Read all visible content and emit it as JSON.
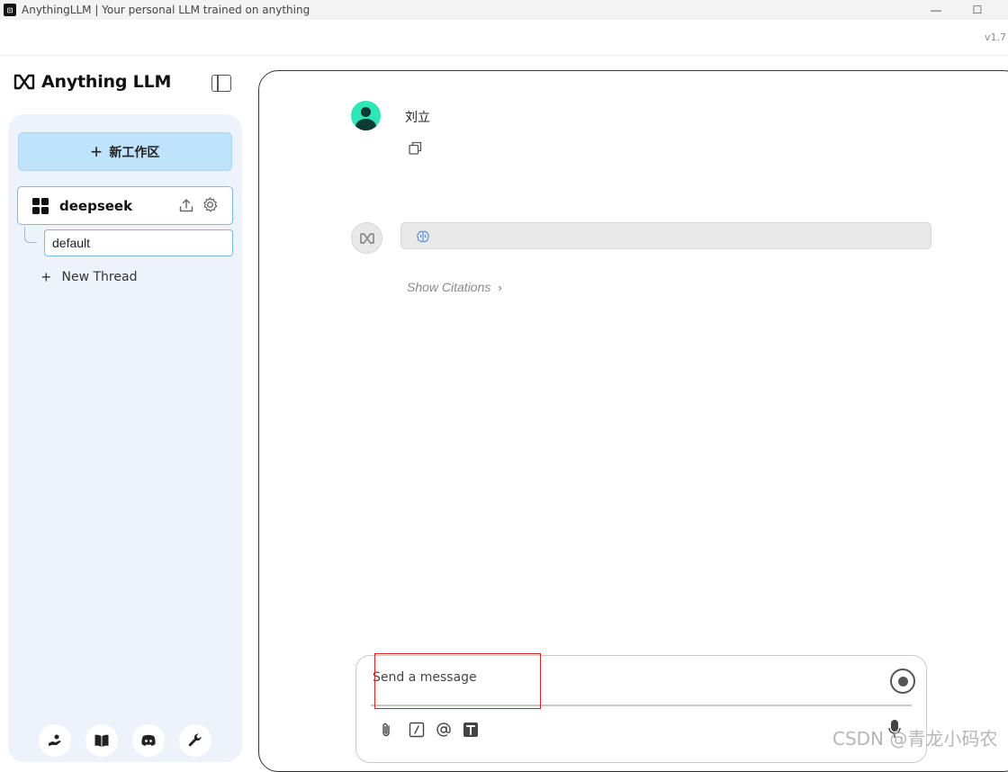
{
  "window": {
    "title": "AnythingLLM | Your personal LLM trained on anything",
    "app_icon_text": "⊡",
    "minimize_glyph": "—",
    "maximize_glyph": "☐",
    "version": "v1.7"
  },
  "sidebar": {
    "logo_text": "Anything LLM",
    "new_workspace_label": "新工作区",
    "workspace": {
      "name": "deepseek"
    },
    "threads": [
      {
        "label": "default"
      }
    ],
    "new_thread_label": "New Thread",
    "footer_buttons": [
      "community-hub-icon",
      "docs-book-icon",
      "discord-icon",
      "settings-wrench-icon"
    ]
  },
  "chat": {
    "messages": [
      {
        "role": "user",
        "text": "刘立"
      },
      {
        "role": "assistant",
        "text": ""
      }
    ],
    "show_citations_label": "Show Citations",
    "chevron": "›"
  },
  "composer": {
    "placeholder": "Send a message",
    "tools": [
      "attach-icon",
      "slash-command-icon",
      "at-mention-icon",
      "text-format-icon"
    ]
  },
  "watermark": "CSDN @青龙小码农",
  "colors": {
    "accent_button": "#bfe3fb",
    "selected_border": "#7fb6ec",
    "sidebar_bg": "#edf2fb",
    "user_avatar": "#2ee6b8",
    "highlight_box": "#e02020"
  }
}
